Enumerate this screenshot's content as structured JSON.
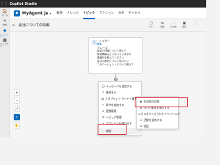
{
  "app": {
    "title": "Copilot Studio"
  },
  "rail": {
    "items": [
      {
        "icon": "🏠",
        "label": "ホーム"
      },
      {
        "icon": "+",
        "label": "作成"
      },
      {
        "icon": "◆",
        "label": "エージェント"
      },
      {
        "icon": "▦",
        "label": "ライブラリ"
      }
    ],
    "active_index": 2
  },
  "agent": {
    "name": "MyAgent ja",
    "tabs": [
      "概要",
      "ナレッジ",
      "トピック",
      "アクション",
      "分析",
      "チャネル"
    ],
    "active_tab": 2
  },
  "topic": {
    "title": "会社についての情報",
    "tools": [
      {
        "icon": "▢",
        "label": "テスト"
      },
      {
        "icon": "⇆",
        "label": "変数"
      },
      {
        "icon": "⋯",
        "label": "その他"
      },
      {
        "icon": "▣",
        "label": "保存"
      },
      {
        "icon": "⋮",
        "label": ""
      }
    ]
  },
  "trigger": {
    "type": "トリガー",
    "edit_label": "編集",
    "label": "フレーズ",
    "phrases": [
      "製品の特徴について教えて",
      "採用情報はどうなっていますか",
      "連絡先を教えてください",
      "会社の歴史について知りたい",
      "このエージェントについて教えて"
    ]
  },
  "menu": {
    "items": [
      {
        "icon": "💬",
        "label": "メッセージを送信する",
        "chevron": false
      },
      {
        "icon": "?",
        "label": "質問する",
        "chevron": false
      },
      {
        "icon": "▤",
        "label": "アダプティブ カードで質問する",
        "chevron": false
      },
      {
        "icon": "⑂",
        "label": "条件を追加する",
        "chevron": false
      },
      {
        "icon": "x",
        "label": "変数管理",
        "chevron": true
      },
      {
        "icon": "☰",
        "label": "トピック管理",
        "chevron": true
      },
      {
        "icon": "⚡",
        "label": "アクションを呼び出す",
        "chevron": true
      },
      {
        "icon": "⋯",
        "label": "詳細",
        "chevron": true
      }
    ]
  },
  "submenu": {
    "items": [
      {
        "icon": "◉",
        "label": "生成型の回答"
      },
      {
        "icon": "⇄",
        "label": "HTTP 要求を送信する"
      },
      {
        "icon": "▭",
        "label": "カスタマイズされたイベントログ"
      },
      {
        "icon": "⏎",
        "label": "活動を送信する"
      },
      {
        "icon": "↯",
        "label": "認証"
      }
    ]
  },
  "zoom": {
    "buttons": [
      {
        "icon": "+"
      },
      {
        "icon": "−"
      },
      {
        "icon": "⤢"
      },
      {
        "icon": "↖"
      },
      {
        "icon": "✋"
      }
    ],
    "selected_index": 3
  },
  "colors": {
    "accent": "#0f6cbd",
    "highlight": "#e0242c",
    "topbar": "#292929"
  }
}
